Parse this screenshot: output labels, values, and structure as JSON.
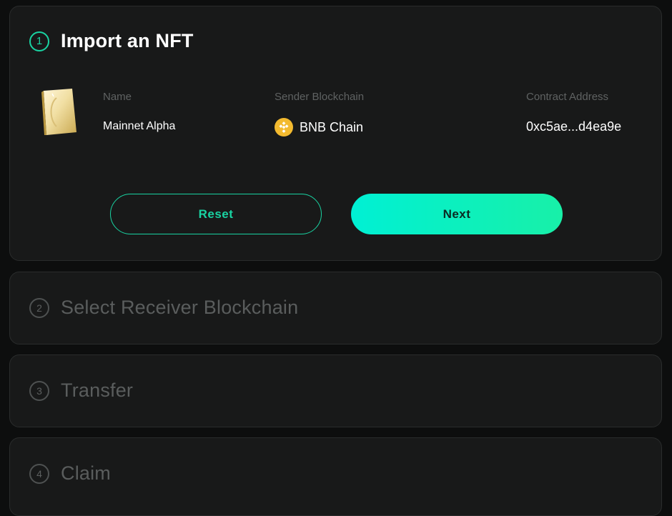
{
  "steps": [
    {
      "number": "1",
      "title": "Import an NFT"
    },
    {
      "number": "2",
      "title": "Select Receiver Blockchain"
    },
    {
      "number": "3",
      "title": "Transfer"
    },
    {
      "number": "4",
      "title": "Claim"
    }
  ],
  "nft": {
    "name_label": "Name",
    "name_value": "Mainnet Alpha",
    "chain_label": "Sender Blockchain",
    "chain_value": "BNB Chain",
    "chain_icon": "bnb-chain-icon",
    "address_label": "Contract Address",
    "address_value": "0xc5ae...d4ea9e"
  },
  "buttons": {
    "reset_label": "Reset",
    "next_label": "Next"
  },
  "colors": {
    "accent": "#19d3a2",
    "next_gradient_start": "#00f0d4",
    "next_gradient_end": "#18f0a8",
    "bnb": "#f3ba2f",
    "card_bg": "#181919",
    "page_bg": "#0d0e0e"
  }
}
